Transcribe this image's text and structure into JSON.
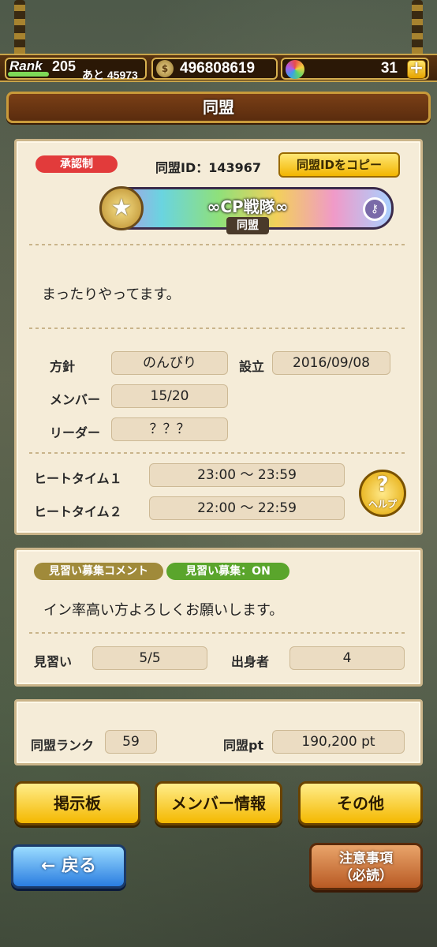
{
  "status_bar": {
    "rank_label": "Rank",
    "rank_value": "205",
    "rank_next": "あと 45973",
    "coin_icon": "bag-icon",
    "coins": "496808619",
    "gem_icon": "gem-icon",
    "gems": "31",
    "plus_label": "+"
  },
  "header": {
    "title": "同盟"
  },
  "alliance": {
    "approval_tag": "承認制",
    "id_label": "同盟ID：143967",
    "copy_button": "同盟IDをコピー",
    "banner_name": "∞CP戦隊∞",
    "banner_sub": "同盟",
    "description": "まったりやってます。",
    "policy_label": "方針",
    "policy_value": "のんびり",
    "founded_label": "設立",
    "founded_value": "2016/09/08",
    "members_label": "メンバー",
    "members_value": "15/20",
    "leader_label": "リーダー",
    "leader_value": "？？？",
    "heat1_label": "ヒートタイム１",
    "heat1_value": "23:00 ～ 23:59",
    "heat2_label": "ヒートタイム２",
    "heat2_value": "22:00 ～ 22:59",
    "help_label": "ヘルプ",
    "help_mark": "?"
  },
  "recruit": {
    "comment_tag": "見習い募集コメント",
    "status_tag": "見習い募集：ON",
    "comment": "イン率高い方よろしくお願いします。",
    "apprentice_label": "見習い",
    "apprentice_value": "5/5",
    "origin_label": "出身者",
    "origin_value": "4"
  },
  "ranking": {
    "rank_label": "同盟ランク",
    "rank_value": "59",
    "pt_label": "同盟pt",
    "pt_value": "190,200 pt"
  },
  "buttons": {
    "board": "掲示板",
    "member_info": "メンバー情報",
    "other": "その他",
    "back": "← 戻る",
    "notice_line1": "注意事項",
    "notice_line2": "（必読）"
  },
  "colors": {
    "accent_gold": "#f4b800",
    "header_brown": "#7a3f16",
    "tag_red": "#e23b3b",
    "tag_green": "#5aa52c"
  }
}
